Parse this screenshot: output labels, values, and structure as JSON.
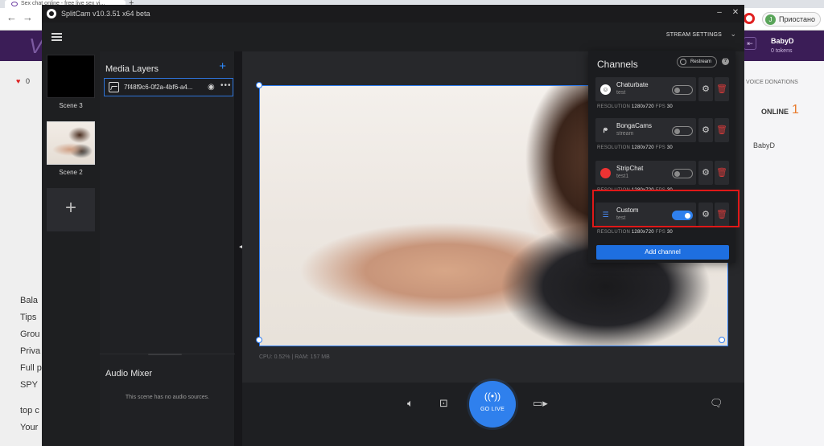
{
  "browser": {
    "tab_title": "Sex chat online - free live sex vi...",
    "new_tab": "+",
    "profile_initial": "J",
    "profile_label": "Приостано",
    "nav_back": "←",
    "nav_forward": "→",
    "nav_reload": "C"
  },
  "site": {
    "logo": "V",
    "user_name": "BabyD",
    "user_tokens": "0 tokens",
    "heart_count": "0",
    "voice_donations": "VOICE DONATIONS",
    "online_label": "ONLINE",
    "online_count": "1",
    "online_user": "BabyD",
    "left_links": [
      "Bala",
      "Tips",
      "Grou",
      "Priva",
      "Full p",
      "SPY"
    ],
    "left_links2": [
      "top c",
      "Your"
    ]
  },
  "app": {
    "title": "SplitCam v10.3.51 x64 beta",
    "stream_settings": "STREAM SETTINGS",
    "scenes": [
      {
        "label": "Scene 3"
      },
      {
        "label": "Scene 2"
      }
    ],
    "add_scene": "+",
    "media_layers": {
      "title": "Media Layers",
      "add": "+",
      "items": [
        {
          "name": "7f48f9c6-0f2a-4bf6-a4..."
        }
      ]
    },
    "audio_mixer": {
      "title": "Audio Mixer",
      "empty_text": "This scene has no audio sources."
    },
    "stats": "CPU: 0.52% | RAM: 157 MB",
    "go_live": "GO LIVE",
    "channels": {
      "title": "Channels",
      "restream": "Restream",
      "help": "?",
      "add_channel": "Add channel",
      "resolution_label": "RESOLUTION",
      "fps_label": "FPS",
      "items": [
        {
          "name": "Chaturbate",
          "sub": "test",
          "enabled": false,
          "resolution": "1280x720",
          "fps": "30"
        },
        {
          "name": "BongaCams",
          "sub": "stream",
          "enabled": false,
          "resolution": "1280x720",
          "fps": "30"
        },
        {
          "name": "StripChat",
          "sub": "test1",
          "enabled": false,
          "resolution": "1280x720",
          "fps": "30"
        },
        {
          "name": "Custom",
          "sub": "test",
          "enabled": true,
          "resolution": "1280x720",
          "fps": "30"
        }
      ]
    }
  },
  "colors": {
    "accent": "#2f80ed",
    "highlight_box": "#e01818",
    "delete": "#d23a3a"
  }
}
